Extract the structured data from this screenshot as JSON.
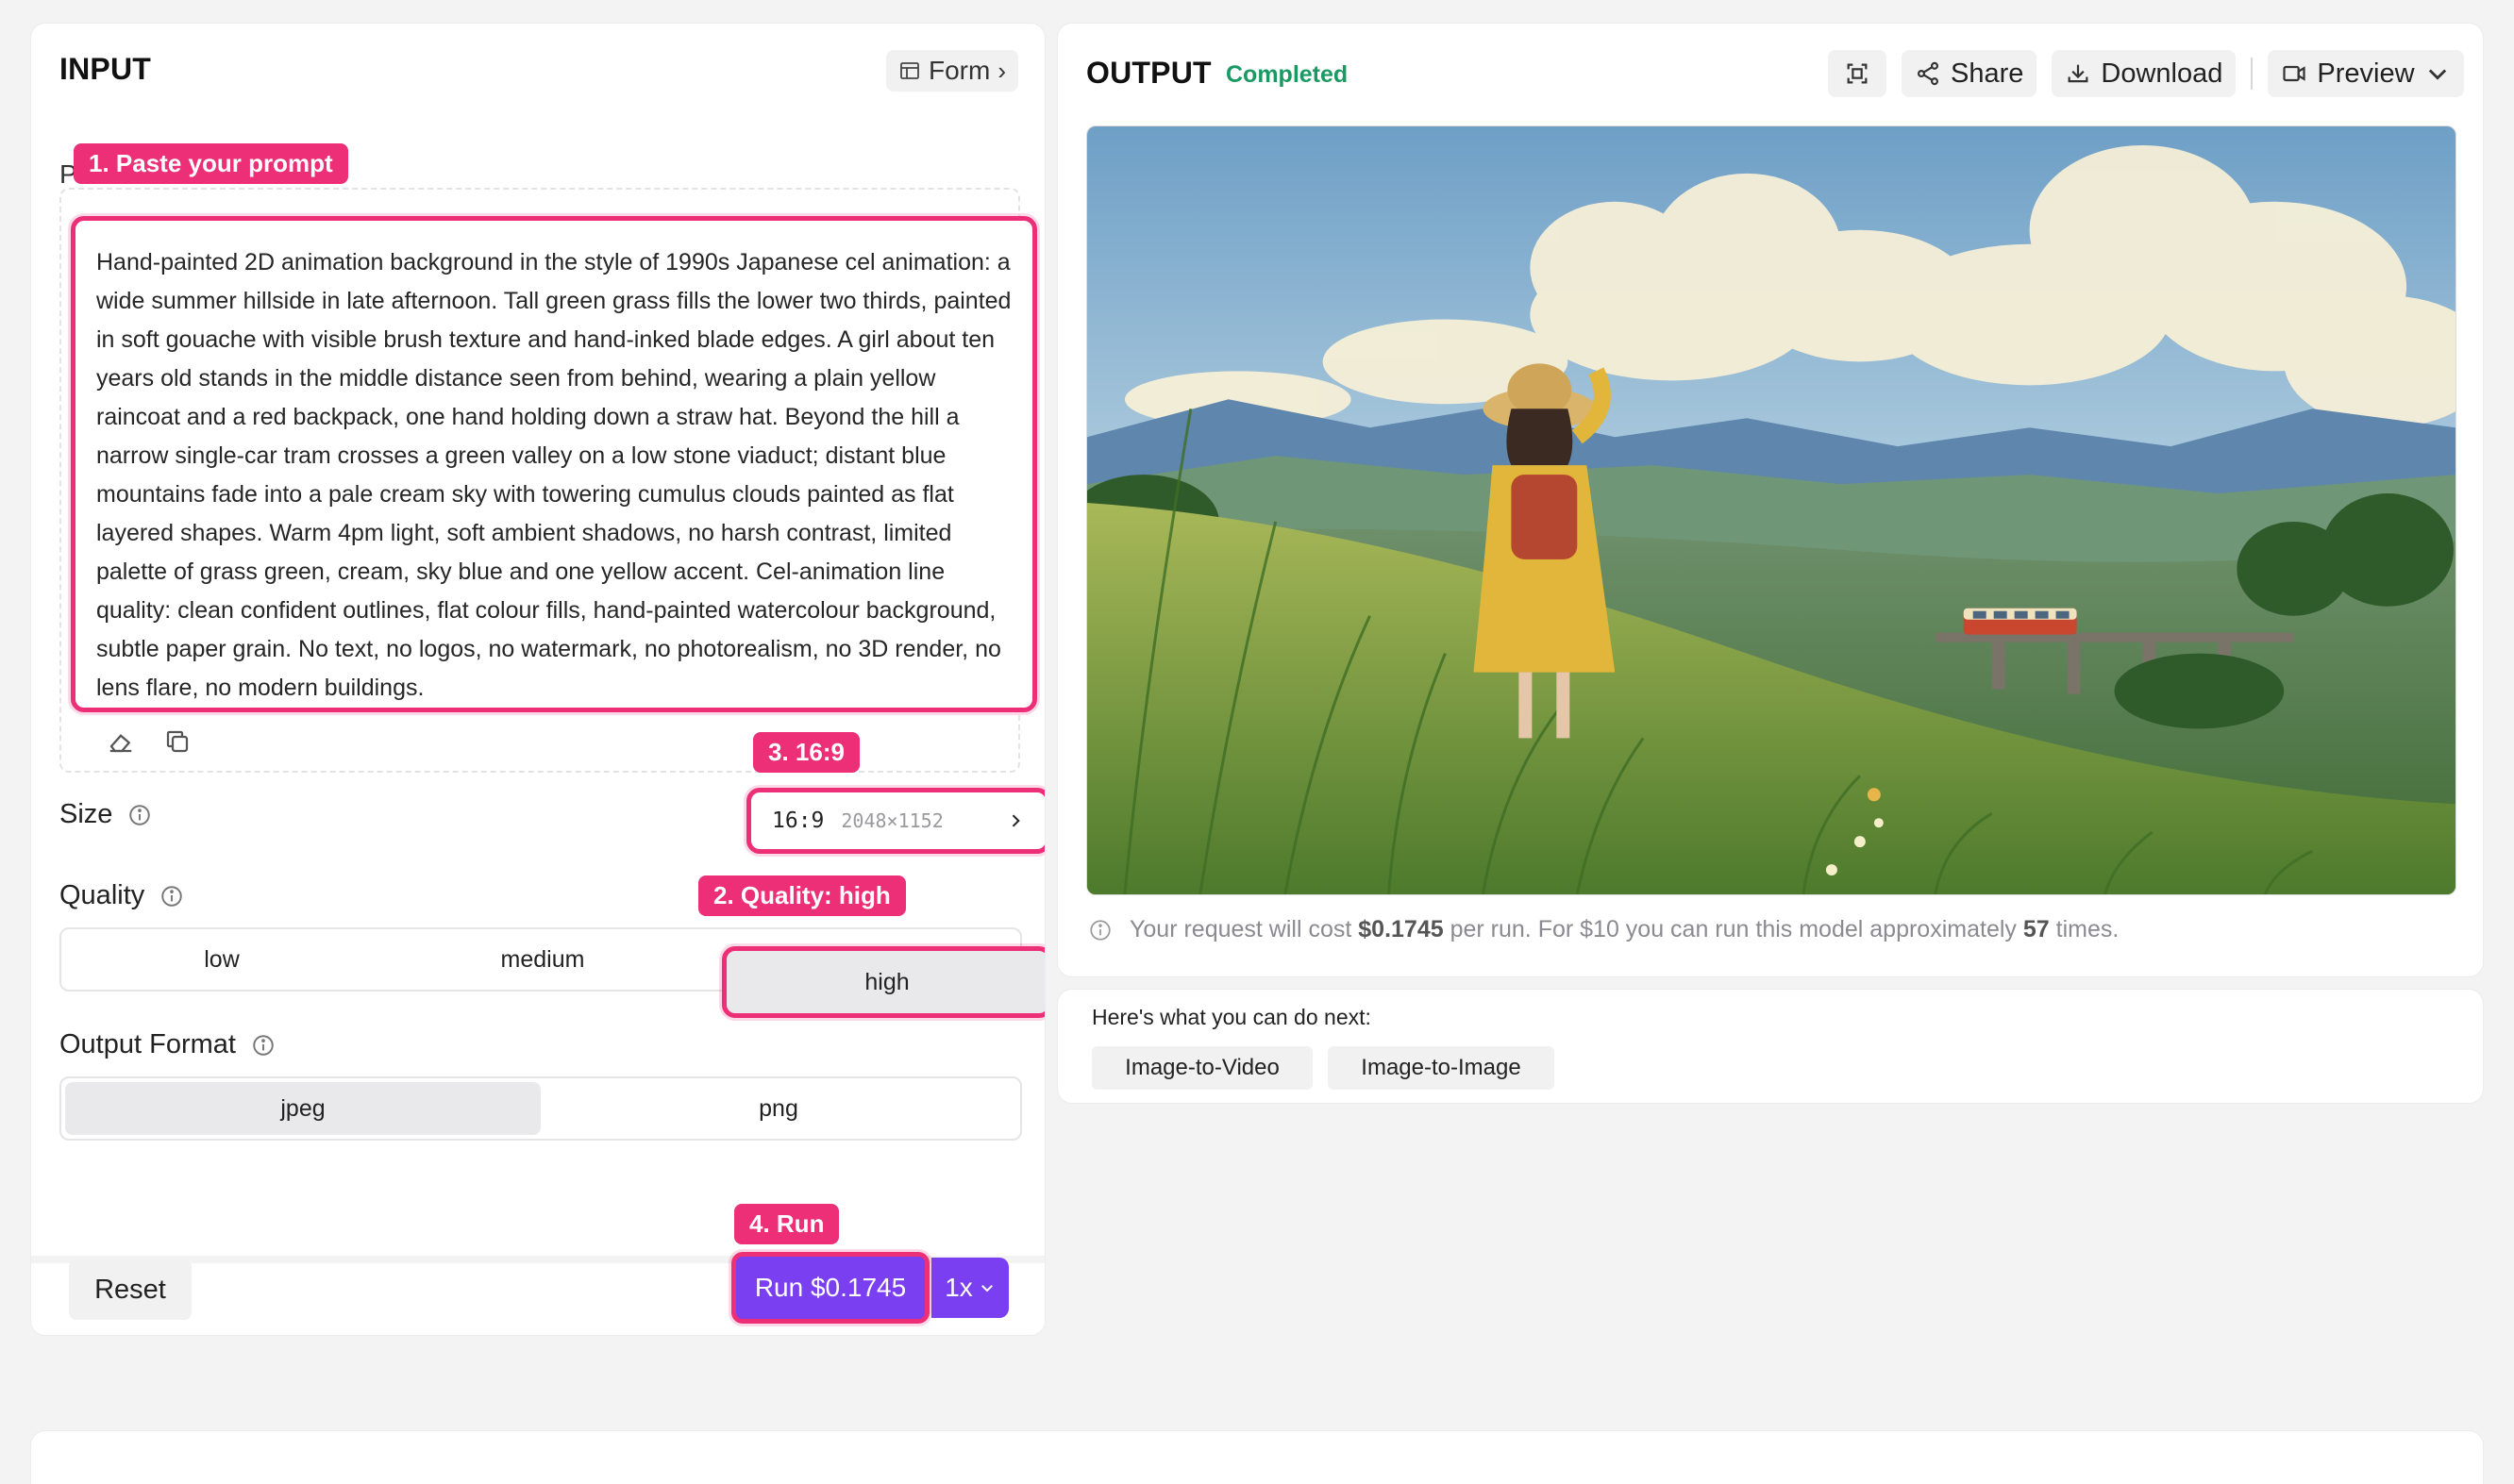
{
  "input": {
    "title": "INPUT",
    "form_button": "Form",
    "prompt_label_partial": "P",
    "prompt_text": "Hand-painted 2D animation background in the style of 1990s Japanese cel animation: a wide summer hillside in late afternoon. Tall green grass fills the lower two thirds, painted in soft gouache with visible brush texture and hand-inked blade edges. A girl about ten years old stands in the middle distance seen from behind, wearing a plain yellow raincoat and a red backpack, one hand holding down a straw hat. Beyond the hill a narrow single-car tram crosses a green valley on a low stone viaduct; distant blue mountains fade into a pale cream sky with towering cumulus clouds painted as flat layered shapes. Warm 4pm light, soft ambient shadows, no harsh contrast, limited palette of grass green, cream, sky blue and one yellow accent. Cel-animation line quality: clean confident outlines, flat colour fills, hand-painted watercolour background, subtle paper grain. No text, no logos, no watermark, no photorealism, no 3D render, no lens flare, no modern buildings.",
    "size": {
      "label": "Size",
      "ratio": "16:9",
      "pixels": "2048×1152"
    },
    "quality": {
      "label": "Quality",
      "options": [
        "low",
        "medium",
        "high"
      ],
      "selected": "high"
    },
    "output_format": {
      "label": "Output Format",
      "options": [
        "jpeg",
        "png"
      ],
      "selected": "jpeg"
    },
    "reset_label": "Reset",
    "run_label": "Run $0.1745",
    "multiplier": "1x"
  },
  "callouts": {
    "c1": "1. Paste your prompt",
    "c2": "2. Quality: high",
    "c3": "3. 16:9",
    "c4": "4. Run"
  },
  "output": {
    "title": "OUTPUT",
    "status": "Completed",
    "share_label": "Share",
    "download_label": "Download",
    "preview_label": "Preview",
    "cost_prefix": "Your request will cost",
    "cost_value": "$0.1745",
    "cost_mid": "per run. For $10 you can run this model approximately",
    "cost_runs": "57",
    "cost_suffix": "times."
  },
  "next": {
    "label": "Here's what you can do next:",
    "actions": [
      "Image-to-Video",
      "Image-to-Image"
    ]
  },
  "colors": {
    "accent_purple": "#7b3ff2",
    "callout_pink": "#ec2f76",
    "status_green": "#1a9a63"
  }
}
